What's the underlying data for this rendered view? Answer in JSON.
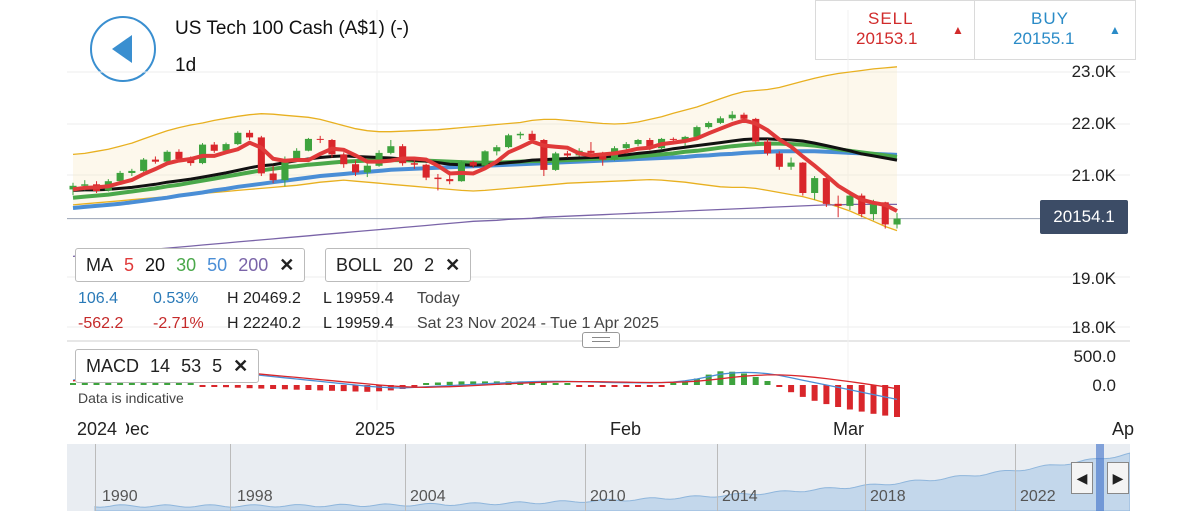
{
  "header": {
    "title": "US Tech 100 Cash (A$1) (-)",
    "interval": "1d"
  },
  "trade": {
    "sell_label": "SELL",
    "sell_value": "20153.1",
    "buy_label": "BUY",
    "buy_value": "20155.1",
    "arrow": "▲"
  },
  "colors": {
    "candle_up": "#3ea33e",
    "candle_down": "#d9262b",
    "ma5": "#e03a3a",
    "ma20": "#111111",
    "ma30": "#4aa84a",
    "ma50": "#4a8ed6",
    "ma200": "#7a64a8",
    "boll": "#e8b020",
    "macd": "#4a8ed6",
    "signal": "#d9262b"
  },
  "current_price_label": "20154.1",
  "indicators": {
    "ma": {
      "label": "MA",
      "periods": [
        "5",
        "20",
        "30",
        "50",
        "200"
      ],
      "close": "✕"
    },
    "boll": {
      "label": "BOLL",
      "params": [
        "20",
        "2"
      ],
      "close": "✕"
    },
    "macd": {
      "label": "MACD",
      "params": [
        "14",
        "53",
        "5"
      ],
      "close": "✕"
    }
  },
  "stats": {
    "row1": {
      "change": "106.4",
      "pct": "0.53%",
      "high": "H 20469.2",
      "low": "L 19959.4",
      "period": "Today"
    },
    "row2": {
      "change": "-562.2",
      "pct": "-2.71%",
      "high": "H 22240.2",
      "low": "L 19959.4",
      "period": "Sat 23 Nov 2024 - Tue 1 Apr 2025"
    }
  },
  "disclaimer": "Data is indicative",
  "x_axis": [
    "2024",
    "Dec",
    "2025",
    "Feb",
    "Mar",
    "Apr"
  ],
  "navigator_years": [
    "1990",
    "1998",
    "2004",
    "2010",
    "2014",
    "2018",
    "2022"
  ],
  "navigator_buttons": {
    "left": "◀",
    "right": "▶"
  },
  "chart_data": {
    "type": "candlestick",
    "y_ticks": [
      "23.0K",
      "22.0K",
      "21.0K",
      "19.0K",
      "18.0K"
    ],
    "macd_ticks": [
      "500.0",
      "0.0"
    ],
    "ylim": [
      17800,
      23300
    ],
    "last_price": 20154.1,
    "candles": [
      {
        "date": "2024-11-25",
        "o": 20720,
        "h": 20850,
        "l": 20610,
        "c": 20790
      },
      {
        "date": "2024-11-26",
        "o": 20790,
        "h": 20900,
        "l": 20700,
        "c": 20820
      },
      {
        "date": "2024-11-27",
        "o": 20820,
        "h": 20880,
        "l": 20650,
        "c": 20690
      },
      {
        "date": "2024-11-29",
        "o": 20700,
        "h": 20920,
        "l": 20680,
        "c": 20880
      },
      {
        "date": "2024-12-02",
        "o": 20880,
        "h": 21080,
        "l": 20850,
        "c": 21040
      },
      {
        "date": "2024-12-03",
        "o": 21040,
        "h": 21120,
        "l": 20980,
        "c": 21080
      },
      {
        "date": "2024-12-04",
        "o": 21080,
        "h": 21330,
        "l": 21060,
        "c": 21300
      },
      {
        "date": "2024-12-05",
        "o": 21300,
        "h": 21360,
        "l": 21220,
        "c": 21260
      },
      {
        "date": "2024-12-06",
        "o": 21260,
        "h": 21480,
        "l": 21240,
        "c": 21450
      },
      {
        "date": "2024-12-09",
        "o": 21450,
        "h": 21500,
        "l": 21270,
        "c": 21310
      },
      {
        "date": "2024-12-10",
        "o": 21310,
        "h": 21360,
        "l": 21180,
        "c": 21230
      },
      {
        "date": "2024-12-11",
        "o": 21230,
        "h": 21620,
        "l": 21210,
        "c": 21590
      },
      {
        "date": "2024-12-12",
        "o": 21590,
        "h": 21640,
        "l": 21430,
        "c": 21470
      },
      {
        "date": "2024-12-13",
        "o": 21470,
        "h": 21630,
        "l": 21440,
        "c": 21600
      },
      {
        "date": "2024-12-16",
        "o": 21600,
        "h": 21850,
        "l": 21580,
        "c": 21820
      },
      {
        "date": "2024-12-17",
        "o": 21820,
        "h": 21870,
        "l": 21680,
        "c": 21730
      },
      {
        "date": "2024-12-18",
        "o": 21730,
        "h": 21760,
        "l": 20980,
        "c": 21030
      },
      {
        "date": "2024-12-19",
        "o": 21030,
        "h": 21180,
        "l": 20840,
        "c": 20900
      },
      {
        "date": "2024-12-20",
        "o": 20900,
        "h": 21360,
        "l": 20780,
        "c": 21300
      },
      {
        "date": "2024-12-23",
        "o": 21300,
        "h": 21520,
        "l": 21260,
        "c": 21470
      },
      {
        "date": "2024-12-24",
        "o": 21470,
        "h": 21720,
        "l": 21460,
        "c": 21700
      },
      {
        "date": "2024-12-26",
        "o": 21700,
        "h": 21760,
        "l": 21620,
        "c": 21680
      },
      {
        "date": "2024-12-27",
        "o": 21680,
        "h": 21700,
        "l": 21340,
        "c": 21400
      },
      {
        "date": "2024-12-30",
        "o": 21400,
        "h": 21440,
        "l": 21140,
        "c": 21210
      },
      {
        "date": "2024-12-31",
        "o": 21210,
        "h": 21280,
        "l": 20980,
        "c": 21050
      },
      {
        "date": "2025-01-02",
        "o": 21050,
        "h": 21250,
        "l": 20960,
        "c": 21180
      },
      {
        "date": "2025-01-03",
        "o": 21180,
        "h": 21480,
        "l": 21160,
        "c": 21430
      },
      {
        "date": "2025-01-06",
        "o": 21430,
        "h": 21680,
        "l": 21400,
        "c": 21560
      },
      {
        "date": "2025-01-07",
        "o": 21560,
        "h": 21600,
        "l": 21180,
        "c": 21230
      },
      {
        "date": "2025-01-08",
        "o": 21230,
        "h": 21300,
        "l": 21120,
        "c": 21200
      },
      {
        "date": "2025-01-10",
        "o": 21200,
        "h": 21220,
        "l": 20900,
        "c": 20950
      },
      {
        "date": "2025-01-13",
        "o": 20950,
        "h": 21020,
        "l": 20700,
        "c": 20920
      },
      {
        "date": "2025-01-14",
        "o": 20920,
        "h": 21080,
        "l": 20820,
        "c": 20880
      },
      {
        "date": "2025-01-15",
        "o": 20880,
        "h": 21280,
        "l": 20870,
        "c": 21250
      },
      {
        "date": "2025-01-16",
        "o": 21250,
        "h": 21280,
        "l": 21140,
        "c": 21180
      },
      {
        "date": "2025-01-17",
        "o": 21180,
        "h": 21480,
        "l": 21160,
        "c": 21460
      },
      {
        "date": "2025-01-21",
        "o": 21460,
        "h": 21580,
        "l": 21380,
        "c": 21540
      },
      {
        "date": "2025-01-22",
        "o": 21540,
        "h": 21800,
        "l": 21520,
        "c": 21770
      },
      {
        "date": "2025-01-23",
        "o": 21770,
        "h": 21840,
        "l": 21700,
        "c": 21800
      },
      {
        "date": "2025-01-24",
        "o": 21800,
        "h": 21860,
        "l": 21650,
        "c": 21680
      },
      {
        "date": "2025-01-27",
        "o": 21680,
        "h": 21700,
        "l": 20980,
        "c": 21100
      },
      {
        "date": "2025-01-28",
        "o": 21100,
        "h": 21450,
        "l": 21080,
        "c": 21420
      },
      {
        "date": "2025-01-29",
        "o": 21420,
        "h": 21470,
        "l": 21340,
        "c": 21380
      },
      {
        "date": "2025-01-30",
        "o": 21380,
        "h": 21520,
        "l": 21360,
        "c": 21470
      },
      {
        "date": "2025-01-31",
        "o": 21470,
        "h": 21640,
        "l": 21400,
        "c": 21430
      },
      {
        "date": "2025-02-03",
        "o": 21430,
        "h": 21450,
        "l": 21180,
        "c": 21300
      },
      {
        "date": "2025-02-04",
        "o": 21300,
        "h": 21560,
        "l": 21280,
        "c": 21520
      },
      {
        "date": "2025-02-05",
        "o": 21520,
        "h": 21640,
        "l": 21480,
        "c": 21600
      },
      {
        "date": "2025-02-06",
        "o": 21600,
        "h": 21700,
        "l": 21560,
        "c": 21680
      },
      {
        "date": "2025-02-07",
        "o": 21680,
        "h": 21720,
        "l": 21480,
        "c": 21520
      },
      {
        "date": "2025-02-10",
        "o": 21520,
        "h": 21720,
        "l": 21500,
        "c": 21700
      },
      {
        "date": "2025-02-11",
        "o": 21700,
        "h": 21730,
        "l": 21640,
        "c": 21680
      },
      {
        "date": "2025-02-12",
        "o": 21680,
        "h": 21760,
        "l": 21560,
        "c": 21740
      },
      {
        "date": "2025-02-13",
        "o": 21740,
        "h": 21960,
        "l": 21720,
        "c": 21930
      },
      {
        "date": "2025-02-14",
        "o": 21930,
        "h": 22040,
        "l": 21900,
        "c": 22010
      },
      {
        "date": "2025-02-18",
        "o": 22010,
        "h": 22140,
        "l": 21990,
        "c": 22100
      },
      {
        "date": "2025-02-19",
        "o": 22100,
        "h": 22240,
        "l": 22060,
        "c": 22170
      },
      {
        "date": "2025-02-20",
        "o": 22170,
        "h": 22210,
        "l": 22020,
        "c": 22090
      },
      {
        "date": "2025-02-21",
        "o": 22090,
        "h": 22110,
        "l": 21600,
        "c": 21650
      },
      {
        "date": "2025-02-24",
        "o": 21650,
        "h": 21700,
        "l": 21380,
        "c": 21420
      },
      {
        "date": "2025-02-25",
        "o": 21420,
        "h": 21460,
        "l": 21100,
        "c": 21160
      },
      {
        "date": "2025-02-26",
        "o": 21160,
        "h": 21340,
        "l": 21100,
        "c": 21240
      },
      {
        "date": "2025-02-27",
        "o": 21240,
        "h": 21250,
        "l": 20600,
        "c": 20650
      },
      {
        "date": "2025-02-28",
        "o": 20650,
        "h": 20980,
        "l": 20520,
        "c": 20940
      },
      {
        "date": "2025-03-03",
        "o": 20940,
        "h": 21000,
        "l": 20380,
        "c": 20440
      },
      {
        "date": "2025-03-04",
        "o": 20440,
        "h": 20600,
        "l": 20180,
        "c": 20400
      },
      {
        "date": "2025-03-05",
        "o": 20400,
        "h": 20650,
        "l": 20320,
        "c": 20600
      },
      {
        "date": "2025-03-06",
        "o": 20600,
        "h": 20640,
        "l": 20180,
        "c": 20240
      },
      {
        "date": "2025-03-07",
        "o": 20240,
        "h": 20520,
        "l": 20120,
        "c": 20470
      },
      {
        "date": "2025-03-10",
        "o": 20470,
        "h": 20480,
        "l": 19960,
        "c": 20040
      },
      {
        "date": "2025-03-11",
        "o": 20040,
        "h": 20260,
        "l": 19960,
        "c": 20154
      }
    ],
    "ma5": [
      20720,
      20750,
      20760,
      20780,
      20844,
      20902,
      21018,
      21116,
      21226,
      21280,
      21310,
      21370,
      21370,
      21440,
      21500,
      21628,
      21530,
      21316,
      21276,
      21294,
      21290,
      21410,
      21510,
      21490,
      21380,
      21260,
      21260,
      21280,
      21320,
      21320,
      21300,
      21180,
      21030,
      21040,
      21030,
      21130,
      21260,
      21440,
      21540,
      21650,
      21570,
      21550,
      21530,
      21420,
      21380,
      21400,
      21420,
      21460,
      21510,
      21530,
      21600,
      21630,
      21660,
      21710,
      21810,
      21900,
      21990,
      22060,
      22000,
      21870,
      21690,
      21550,
      21360,
      21180,
      20990,
      20790,
      20650,
      20520,
      20460,
      20420,
      20300
    ],
    "ma20": [
      20700,
      20710,
      20710,
      20720,
      20740,
      20760,
      20790,
      20820,
      20860,
      20890,
      20920,
      20960,
      21000,
      21040,
      21090,
      21140,
      21180,
      21200,
      21240,
      21280,
      21310,
      21340,
      21360,
      21370,
      21360,
      21350,
      21340,
      21330,
      21310,
      21290,
      21270,
      21240,
      21210,
      21200,
      21190,
      21200,
      21220,
      21240,
      21260,
      21290,
      21300,
      21310,
      21320,
      21330,
      21340,
      21350,
      21370,
      21390,
      21420,
      21440,
      21470,
      21510,
      21540,
      21570,
      21600,
      21630,
      21660,
      21690,
      21700,
      21700,
      21690,
      21680,
      21660,
      21620,
      21570,
      21520,
      21470,
      21410,
      21370,
      21330,
      21290
    ],
    "ma30": [
      20560,
      20580,
      20600,
      20620,
      20650,
      20680,
      20710,
      20740,
      20780,
      20810,
      20850,
      20890,
      20930,
      20970,
      21010,
      21050,
      21090,
      21120,
      21150,
      21170,
      21200,
      21220,
      21240,
      21260,
      21270,
      21280,
      21290,
      21290,
      21290,
      21280,
      21280,
      21270,
      21260,
      21250,
      21240,
      21240,
      21240,
      21250,
      21260,
      21270,
      21270,
      21280,
      21290,
      21300,
      21310,
      21320,
      21330,
      21340,
      21360,
      21380,
      21400,
      21420,
      21450,
      21470,
      21500,
      21530,
      21560,
      21580,
      21600,
      21610,
      21610,
      21600,
      21590,
      21570,
      21540,
      21500,
      21470,
      21440,
      21410,
      21380,
      21350
    ],
    "ma50": [
      20360,
      20380,
      20400,
      20420,
      20440,
      20470,
      20500,
      20530,
      20560,
      20600,
      20630,
      20660,
      20700,
      20730,
      20770,
      20800,
      20830,
      20860,
      20890,
      20920,
      20950,
      20980,
      21000,
      21020,
      21040,
      21060,
      21080,
      21100,
      21110,
      21120,
      21130,
      21140,
      21150,
      21160,
      21170,
      21180,
      21190,
      21200,
      21210,
      21220,
      21230,
      21240,
      21250,
      21260,
      21270,
      21280,
      21290,
      21300,
      21310,
      21320,
      21330,
      21340,
      21350,
      21370,
      21380,
      21400,
      21410,
      21430,
      21440,
      21450,
      21460,
      21460,
      21460,
      21460,
      21450,
      21440,
      21430,
      21420,
      21410,
      21400,
      21390
    ],
    "ma200": [
      19420,
      19440,
      19460,
      19480,
      19500,
      19520,
      19540,
      19560,
      19580,
      19600,
      19620,
      19640,
      19660,
      19680,
      19700,
      19720,
      19740,
      19760,
      19780,
      19800,
      19820,
      19840,
      19860,
      19880,
      19900,
      19920,
      19940,
      19960,
      19980,
      20000,
      20020,
      20040,
      20060,
      20080,
      20100,
      20110,
      20120,
      20140,
      20150,
      20160,
      20180,
      20190,
      20200,
      20210,
      20220,
      20230,
      20240,
      20250,
      20260,
      20270,
      20280,
      20290,
      20300,
      20310,
      20320,
      20330,
      20340,
      20350,
      20360,
      20370,
      20380,
      20390,
      20400,
      20410,
      20420,
      20420,
      20430,
      20430,
      20430,
      20430,
      20430
    ],
    "boll_upper": [
      21400,
      21420,
      21460,
      21500,
      21560,
      21620,
      21700,
      21780,
      21860,
      21920,
      21970,
      22010,
      22060,
      22100,
      22140,
      22170,
      22190,
      22180,
      22160,
      22140,
      22120,
      22080,
      22020,
      21960,
      21900,
      21860,
      21840,
      21840,
      21850,
      21860,
      21870,
      21880,
      21900,
      21920,
      21940,
      21960,
      21980,
      22000,
      22020,
      22060,
      22080,
      22080,
      22060,
      22040,
      22020,
      22000,
      21990,
      22000,
      22030,
      22080,
      22130,
      22200,
      22260,
      22320,
      22400,
      22480,
      22560,
      22620,
      22640,
      22660,
      22700,
      22760,
      22820,
      22880,
      22930,
      22970,
      23000,
      23030,
      23060,
      23080,
      23100
    ],
    "boll_lower": [
      20420,
      20440,
      20460,
      20480,
      20500,
      20520,
      20540,
      20560,
      20580,
      20600,
      20620,
      20640,
      20660,
      20680,
      20700,
      20720,
      20740,
      20760,
      20780,
      20800,
      20830,
      20860,
      20880,
      20900,
      20880,
      20860,
      20840,
      20820,
      20800,
      20780,
      20760,
      20740,
      20720,
      20700,
      20690,
      20700,
      20720,
      20740,
      20760,
      20780,
      20800,
      20820,
      20840,
      20850,
      20860,
      20870,
      20880,
      20890,
      20900,
      20910,
      20900,
      20880,
      20860,
      20830,
      20800,
      20770,
      20760,
      20760,
      20740,
      20700,
      20660,
      20620,
      20580,
      20520,
      20450,
      20380,
      20300,
      20200,
      20100,
      20000,
      19920
    ],
    "macd": [
      80,
      110,
      140,
      170,
      200,
      225,
      250,
      265,
      275,
      280,
      270,
      255,
      240,
      220,
      200,
      180,
      160,
      140,
      120,
      100,
      80,
      60,
      40,
      20,
      0,
      -20,
      -35,
      -45,
      -50,
      -40,
      -30,
      -20,
      -10,
      0,
      10,
      20,
      30,
      40,
      50,
      55,
      60,
      62,
      60,
      55,
      50,
      45,
      40,
      38,
      36,
      35,
      40,
      50,
      70,
      100,
      140,
      180,
      200,
      210,
      205,
      190,
      160,
      120,
      80,
      40,
      0,
      -40,
      -80,
      -120,
      -160,
      -200,
      -240
    ],
    "signal": [
      70,
      95,
      120,
      150,
      180,
      205,
      230,
      250,
      262,
      270,
      268,
      260,
      248,
      232,
      215,
      198,
      180,
      162,
      144,
      126,
      108,
      90,
      72,
      54,
      36,
      18,
      0,
      -15,
      -28,
      -36,
      -38,
      -34,
      -28,
      -20,
      -10,
      0,
      10,
      20,
      30,
      38,
      46,
      52,
      56,
      57,
      56,
      53,
      50,
      47,
      44,
      42,
      42,
      45,
      52,
      64,
      82,
      104,
      126,
      146,
      160,
      168,
      168,
      160,
      146,
      128,
      106,
      82,
      56,
      28,
      0,
      -30,
      -62
    ],
    "hist_note": ""
  }
}
